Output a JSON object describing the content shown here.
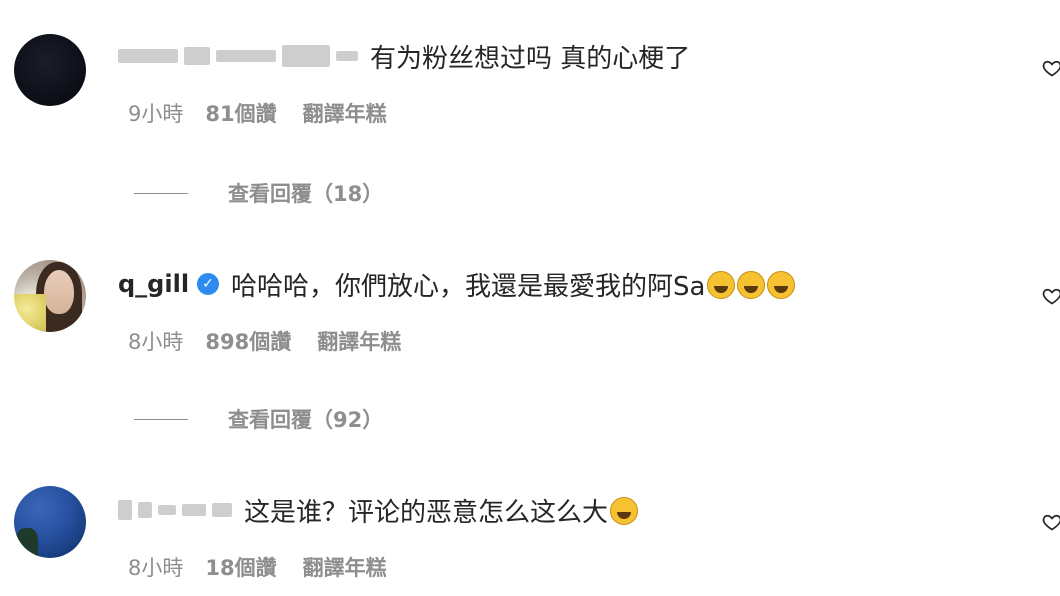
{
  "comments": [
    {
      "username_blurred": true,
      "text": "有为粉丝想过吗 真的心梗了",
      "time": "9小時",
      "likes": "81個讚",
      "translate": "翻譯年糕",
      "replies": "查看回覆（18）",
      "avatar": "dark-night-avatar"
    },
    {
      "username": "q_gill",
      "verified": true,
      "text": "哈哈哈，你們放心，我還是最愛我的阿Sa",
      "emojis": [
        "tears-of-joy-emoji",
        "tears-of-joy-emoji",
        "tears-of-joy-emoji"
      ],
      "time": "8小時",
      "likes": "898個讚",
      "translate": "翻譯年糕",
      "replies": "查看回覆（92）",
      "avatar": "woman-portrait-avatar"
    },
    {
      "username_blurred": true,
      "text": "这是谁？评论的恶意怎么这么大",
      "emojis": [
        "thinking-face-emoji"
      ],
      "time": "8小時",
      "likes": "18個讚",
      "translate": "翻譯年糕",
      "avatar": "blue-sky-avatar"
    }
  ],
  "colors": {
    "text": "#262626",
    "meta": "#8e8e8e",
    "verified": "#2d8af0",
    "emoji": "#f6c232"
  },
  "icons": {
    "like": "heart-icon",
    "verified": "verified-badge-icon"
  }
}
